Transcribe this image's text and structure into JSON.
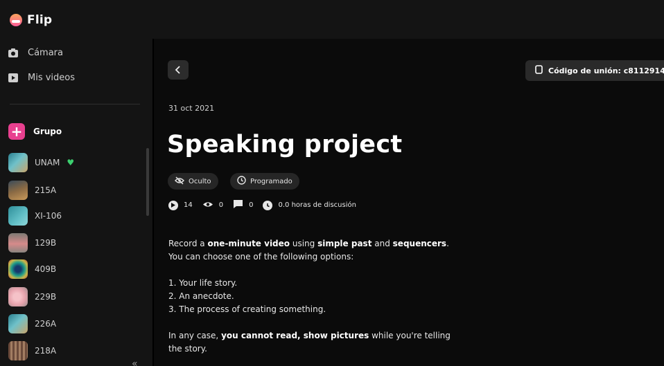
{
  "app": {
    "name": "Flip"
  },
  "sidebar": {
    "nav": [
      {
        "label": "Cámara",
        "icon": "camera-icon"
      },
      {
        "label": "Mis videos",
        "icon": "video-icon"
      }
    ],
    "group_label": "Grupo",
    "groups": [
      {
        "name": "UNAM",
        "favorite": true
      },
      {
        "name": "215A"
      },
      {
        "name": "XI-106"
      },
      {
        "name": "129B"
      },
      {
        "name": "409B"
      },
      {
        "name": "229B"
      },
      {
        "name": "226A"
      },
      {
        "name": "218A"
      }
    ],
    "collapse_glyph": "«"
  },
  "topic": {
    "join_code": "Código de unión: c8112914",
    "date": "31 oct 2021",
    "title": "Speaking project",
    "chips": {
      "hidden": "Oculto",
      "scheduled": "Programado"
    },
    "stats": {
      "videos": "14",
      "views": "0",
      "comments": "0",
      "hours": "0.0 horas de discusión"
    },
    "description": {
      "l1_a": "Record a ",
      "l1_b": "one-minute video",
      "l1_c": " using ",
      "l1_d": "simple past",
      "l1_e": " and ",
      "l1_f": "sequencers",
      "l1_g": ".",
      "l2": "You can choose one of the following options:",
      "o1": "1. Your life story.",
      "o2": "2. An anecdote.",
      "o3": "3. The process of creating something.",
      "l3_a": "In any case, ",
      "l3_b": "you cannot read, show pictures",
      "l3_c": " while you're telling",
      "l4": "the story."
    }
  },
  "colors": {
    "accent": "#e8408f",
    "favorite": "#3ccf6f"
  }
}
